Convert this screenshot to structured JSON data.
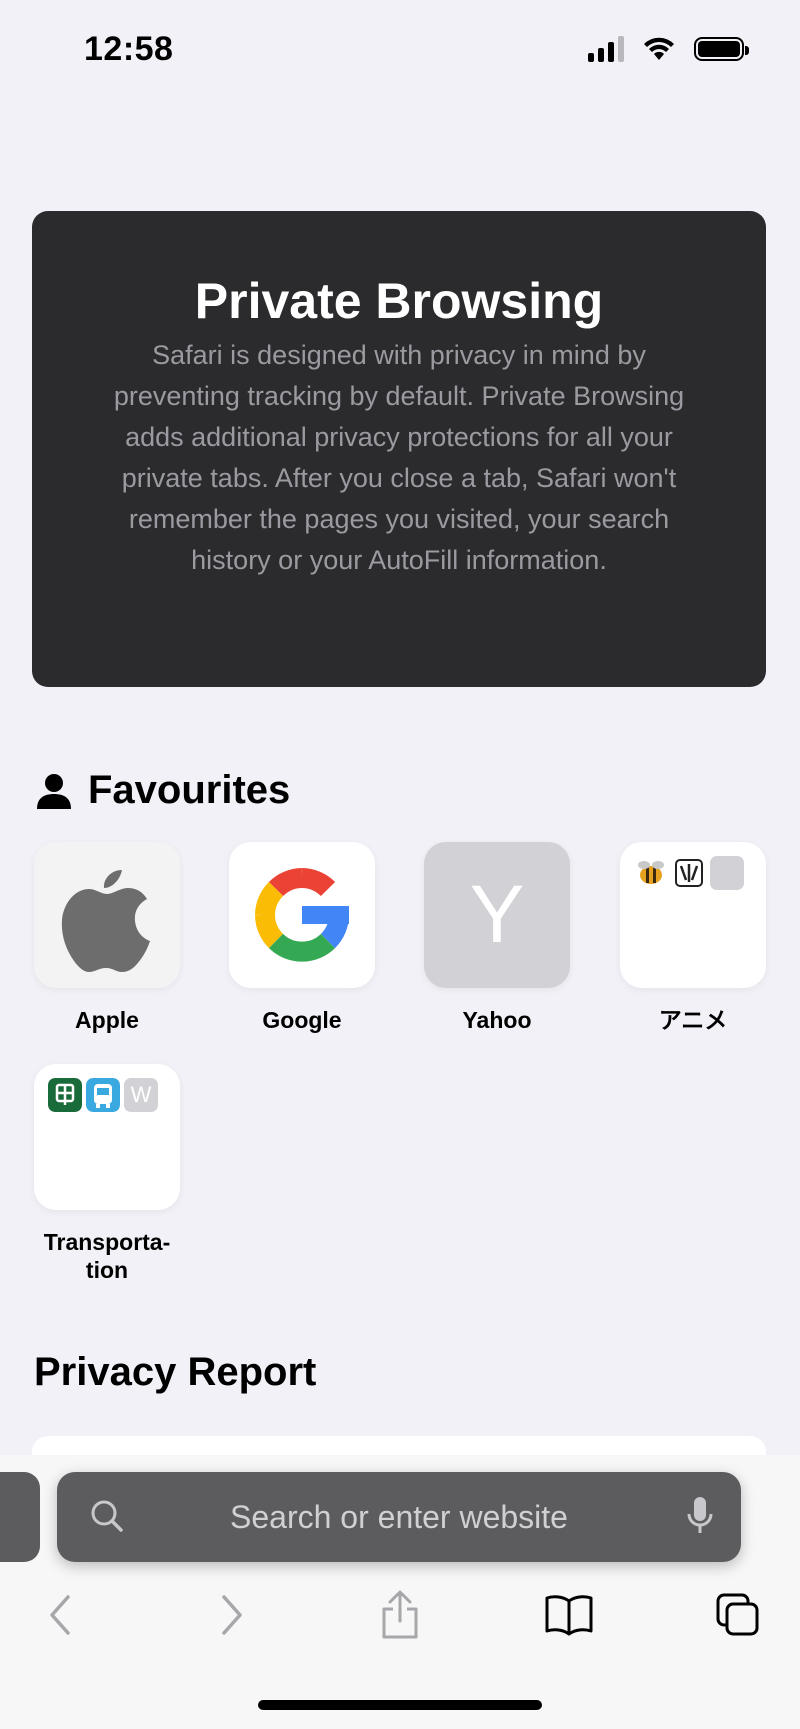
{
  "status_bar": {
    "time": "12:58"
  },
  "private_browsing": {
    "title": "Private Browsing",
    "description": "Safari is designed with privacy in mind by preventing tracking by default. Private Browsing adds additional privacy protections for all your private tabs. After you close a tab, Safari won't remember the pages you visited, your search history or your AutoFill information."
  },
  "favourites": {
    "title": "Favourites",
    "items": [
      {
        "label": "Apple",
        "icon": "apple-logo-icon"
      },
      {
        "label": "Google",
        "icon": "google-logo-icon"
      },
      {
        "label": "Yahoo",
        "letter": "Y"
      },
      {
        "label": "アニメ",
        "icon": "folder-icon"
      },
      {
        "label": "Transporta-\ntion",
        "icon": "folder-icon",
        "mini_letter": "W"
      }
    ]
  },
  "privacy_report": {
    "title": "Privacy Report"
  },
  "search": {
    "placeholder": "Search or enter website"
  },
  "toolbar": {
    "back": "chevron-left-icon",
    "forward": "chevron-right-icon",
    "share": "share-icon",
    "bookmarks": "book-icon",
    "tabs": "tabs-icon"
  },
  "colors": {
    "background": "#f2f1f7",
    "private_card": "#2b2b2e",
    "search_bar": "#5c5c5f",
    "yahoo_tile": "#d1d1d6"
  }
}
